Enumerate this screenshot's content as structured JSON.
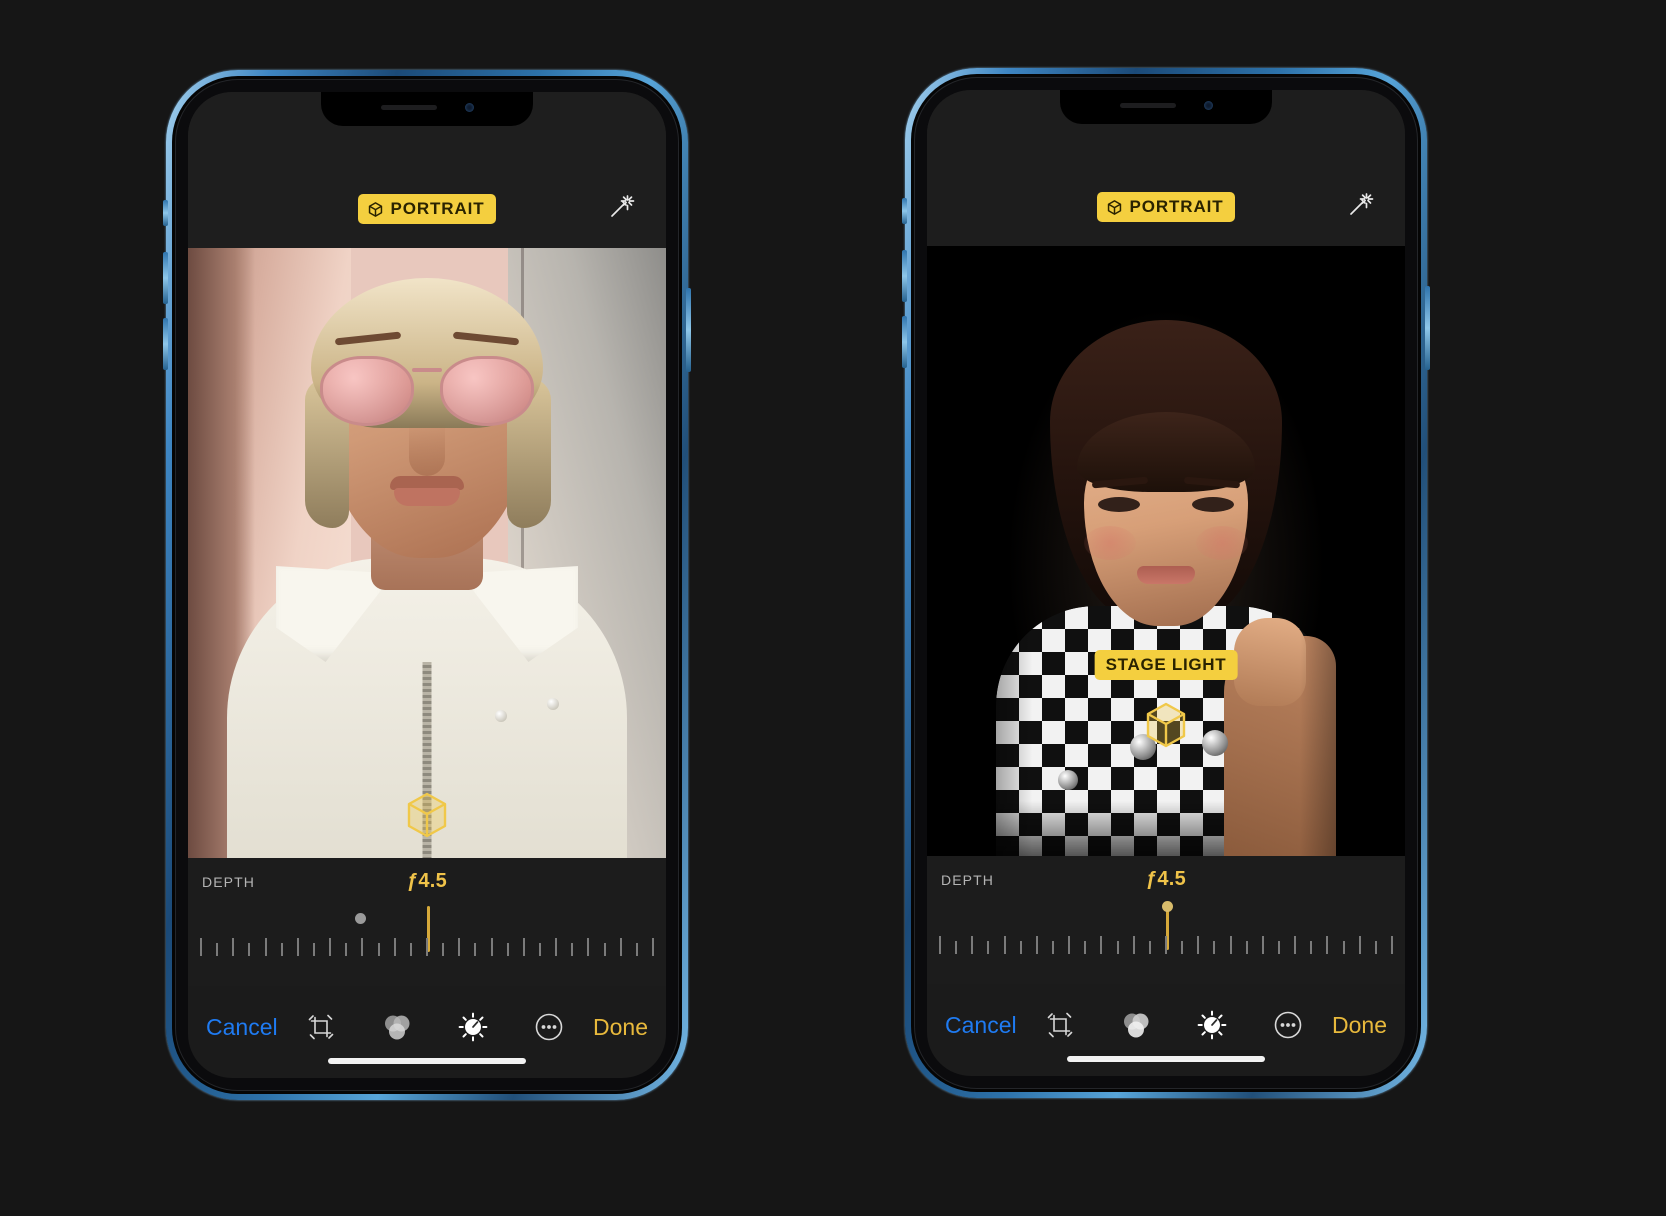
{
  "page": {
    "background_color": "#161616",
    "caption": ""
  },
  "phones": [
    {
      "id": "phone-left",
      "device_color": "#3f87c4",
      "topbar": {
        "mode_badge": {
          "label": "PORTRAIT",
          "icon": "cube-icon",
          "bg": "#f4cf3f",
          "fg": "#2a2300"
        },
        "auto_enhance_icon": "magic-wand-icon"
      },
      "photo": {
        "scene": "woman-with-pink-sunglasses-against-sunlit-wall",
        "depth_cube_icon": "depth-cube-icon",
        "light_badge": null
      },
      "depth": {
        "label": "DEPTH",
        "value": "ƒ4.5",
        "aperture": 4.5,
        "marker_percent": 50,
        "dot_percent": 35,
        "tick_count": 29,
        "marker_color": "#d6a93a",
        "dot_color": "#9a9a9a",
        "dot_above": false
      },
      "toolbar": {
        "cancel_label": "Cancel",
        "done_label": "Done",
        "cancel_color": "#1f7bf2",
        "done_color": "#e8b93c",
        "icons": [
          {
            "name": "crop-icon",
            "active": false
          },
          {
            "name": "filters-icon",
            "active": false
          },
          {
            "name": "adjust-dial-icon",
            "active": true
          },
          {
            "name": "more-ellipsis-icon",
            "active": false
          }
        ]
      }
    },
    {
      "id": "phone-right",
      "device_color": "#3f87c4",
      "topbar": {
        "mode_badge": {
          "label": "PORTRAIT",
          "icon": "cube-icon",
          "bg": "#f4cf3f",
          "fg": "#2a2300"
        },
        "auto_enhance_icon": "magic-wand-icon"
      },
      "photo": {
        "scene": "girl-in-checkered-top-on-black-stage-light-background",
        "depth_cube_icon": "depth-cube-icon",
        "light_badge": {
          "label": "STAGE LIGHT",
          "bg": "#f4cf3f",
          "fg": "#2a2300"
        }
      },
      "depth": {
        "label": "DEPTH",
        "value": "ƒ4.5",
        "aperture": 4.5,
        "marker_percent": 50,
        "dot_percent": 50,
        "tick_count": 29,
        "marker_color": "#d6a93a",
        "dot_color": "#d9bc6b",
        "dot_above": true
      },
      "toolbar": {
        "cancel_label": "Cancel",
        "done_label": "Done",
        "cancel_color": "#1f7bf2",
        "done_color": "#e8b93c",
        "icons": [
          {
            "name": "crop-icon",
            "active": false
          },
          {
            "name": "filters-icon",
            "active": true
          },
          {
            "name": "adjust-dial-icon",
            "active": false
          },
          {
            "name": "more-ellipsis-icon",
            "active": false
          }
        ]
      }
    }
  ]
}
